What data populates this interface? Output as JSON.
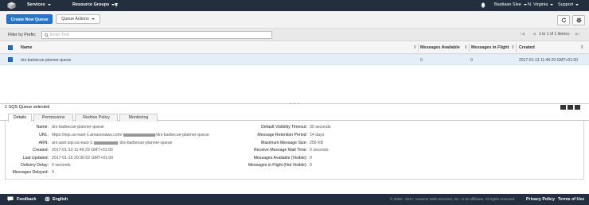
{
  "topnav": {
    "services": "Services",
    "resource_groups": "Resource Groups",
    "user": "Bastiaan Slee",
    "region": "N. Virginia",
    "support": "Support"
  },
  "toolbar": {
    "create_button": "Create New Queue",
    "actions_button": "Queue Actions"
  },
  "filter": {
    "label": "Filter by Prefix:",
    "placeholder": "Enter Text"
  },
  "pager": {
    "text": "1 to 1 of 1 items"
  },
  "table": {
    "columns": [
      "Name",
      "Messages Available",
      "Messages in Flight",
      "Created"
    ],
    "rows": [
      {
        "name": "drs-barbecue-planner-queue",
        "available": "0",
        "in_flight": "0",
        "created": "2017-01-13 11:46:29 GMT+01:00"
      }
    ]
  },
  "selection_status": "1 SQS Queue selected",
  "tabs": [
    "Details",
    "Permissions",
    "Redrive Policy",
    "Monitoring"
  ],
  "details_left": [
    {
      "key": "Name:",
      "value": "drs-barbecue-planner-queue"
    },
    {
      "key": "URL:",
      "value_pre": "https://sqs.us-east-1.amazonaws.com/",
      "value_post": "/drs-barbecue-planner-queue"
    },
    {
      "key": "ARN:",
      "value_pre": "arn:aws:sqs:us-east-1:",
      "value_post": ":drs-barbecue-planner-queue"
    },
    {
      "key": "Created:",
      "value": "2017-01-13 11:46:29 GMT+01:00"
    },
    {
      "key": "Last Updated:",
      "value": "2017-01-15 20:36:52 GMT+01:00"
    },
    {
      "key": "Delivery Delay:",
      "value": "0 seconds"
    },
    {
      "key": "Messages Delayed:",
      "value": "0"
    }
  ],
  "details_right": [
    {
      "key": "Default Visibility Timeout:",
      "value": "30 seconds"
    },
    {
      "key": "Message Retention Period:",
      "value": "14 days"
    },
    {
      "key": "Maximum Message Size:",
      "value": "256 KB"
    },
    {
      "key": "Receive Message Wait Time:",
      "value": "0 seconds"
    },
    {
      "key": "Messages Available (Visible):",
      "value": "0"
    },
    {
      "key": "Messages in Flight (Not Visible):",
      "value": "0"
    }
  ],
  "footer": {
    "feedback": "Feedback",
    "language": "English",
    "copyright": "© 2008 - 2017, Amazon Web Services, Inc. or its affiliates. All rights reserved.",
    "privacy": "Privacy Policy",
    "terms": "Terms of Use"
  },
  "colors": {
    "nav_bg": "#232f3e",
    "primary": "#2775c9",
    "selected_row": "#e4eef9"
  }
}
